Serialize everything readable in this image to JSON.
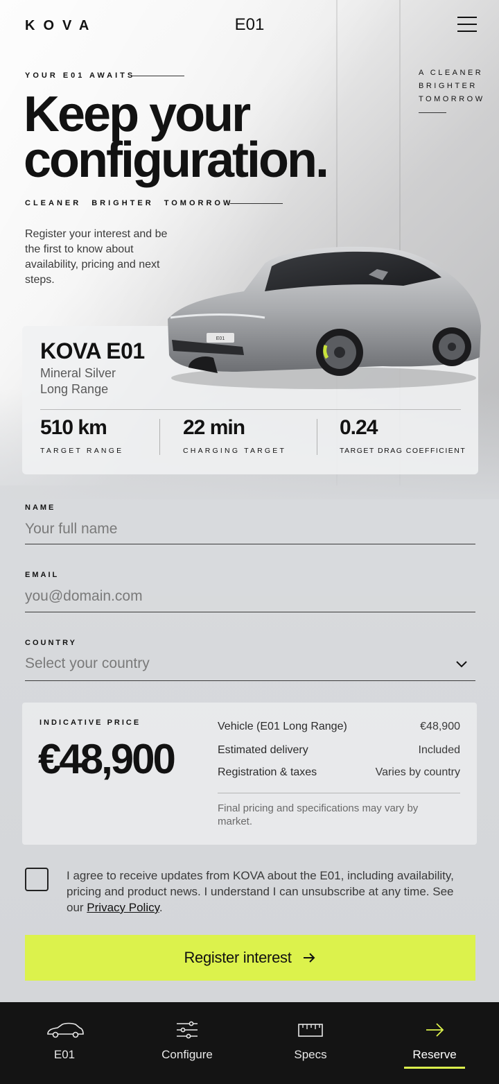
{
  "header": {
    "brand": "KOVA",
    "model": "E01"
  },
  "hero": {
    "eyebrow": "YOUR E01 AWAITS",
    "side_tag": [
      "A CLEANER",
      "BRIGHTER",
      "TOMORROW"
    ],
    "headline_line1": "Keep your",
    "headline_line2": "configuration.",
    "tagline": "CLEANER BRIGHTER TOMORROW",
    "intro": "Register your interest and be the first to know about availability, pricing and next steps."
  },
  "car_card": {
    "name": "KOVA E01",
    "color": "Mineral Silver",
    "variant": "Long Range",
    "stats": [
      {
        "value": "510 km",
        "label": "TARGET RANGE"
      },
      {
        "value": "22 min",
        "label": "CHARGING TARGET"
      },
      {
        "value": "0.24",
        "label": "TARGET DRAG COEFFICIENT"
      }
    ]
  },
  "form": {
    "name_label": "NAME",
    "name_placeholder": "Your full name",
    "email_label": "EMAIL",
    "email_placeholder": "you@domain.com",
    "country_label": "COUNTRY",
    "country_placeholder": "Select your country"
  },
  "price": {
    "label": "INDICATIVE PRICE",
    "value": "€48,900",
    "rows": [
      {
        "key": "Vehicle (E01 Long Range)",
        "value": "€48,900"
      },
      {
        "key": "Estimated delivery",
        "value": "Included"
      },
      {
        "key": "Registration & taxes",
        "value": "Varies by country"
      }
    ],
    "note": "Final pricing and specifications may vary by market."
  },
  "consent": {
    "text": "I agree to receive updates from KOVA about the E01, including availability, pricing and product news. I understand I can unsubscribe at any time. See our ",
    "link": "Privacy Policy",
    "end": "."
  },
  "cta": {
    "label": "Register interest"
  },
  "nav": {
    "items": [
      {
        "label": "E01",
        "icon": "car-icon"
      },
      {
        "label": "Configure",
        "icon": "sliders-icon"
      },
      {
        "label": "Specs",
        "icon": "ruler-icon"
      },
      {
        "label": "Reserve",
        "icon": "arrow-right-icon"
      }
    ],
    "active_index": 3
  },
  "colors": {
    "accent": "#dcf24c",
    "nav_bg": "#141414"
  }
}
